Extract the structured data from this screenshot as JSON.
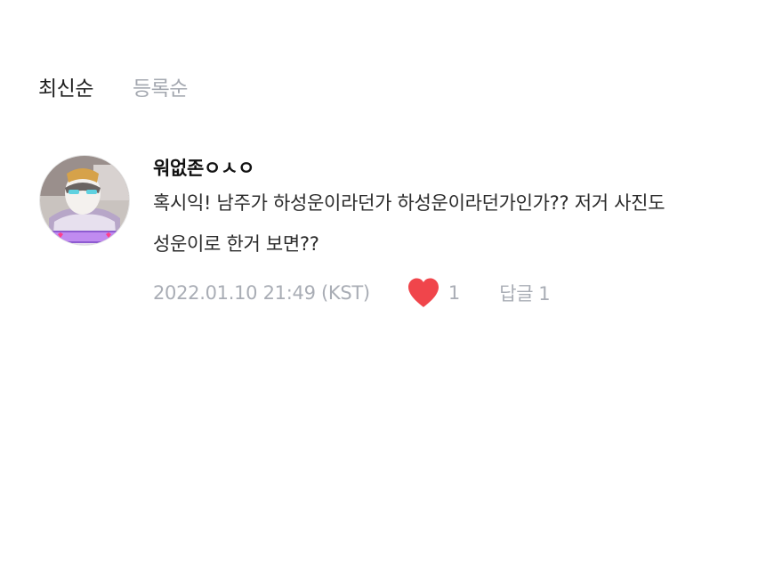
{
  "sort_tabs": [
    {
      "label": "최신순",
      "active": true
    },
    {
      "label": "등록순",
      "active": false
    }
  ],
  "comment": {
    "avatar_icon": "avatar-photo",
    "nickname": "워없존ㅇㅅㅇ",
    "text_lines": [
      "혹시익! 남주가 하성운이라던가 하성운이라던가인가?? 저거 사진도",
      "성운이로 한거 보면??"
    ],
    "timestamp": "2022.01.10 21:49 (KST)",
    "like_icon": "heart-icon",
    "like_color": "#f0454b",
    "like_count": "1",
    "reply_label": "답글",
    "reply_count": "1"
  }
}
